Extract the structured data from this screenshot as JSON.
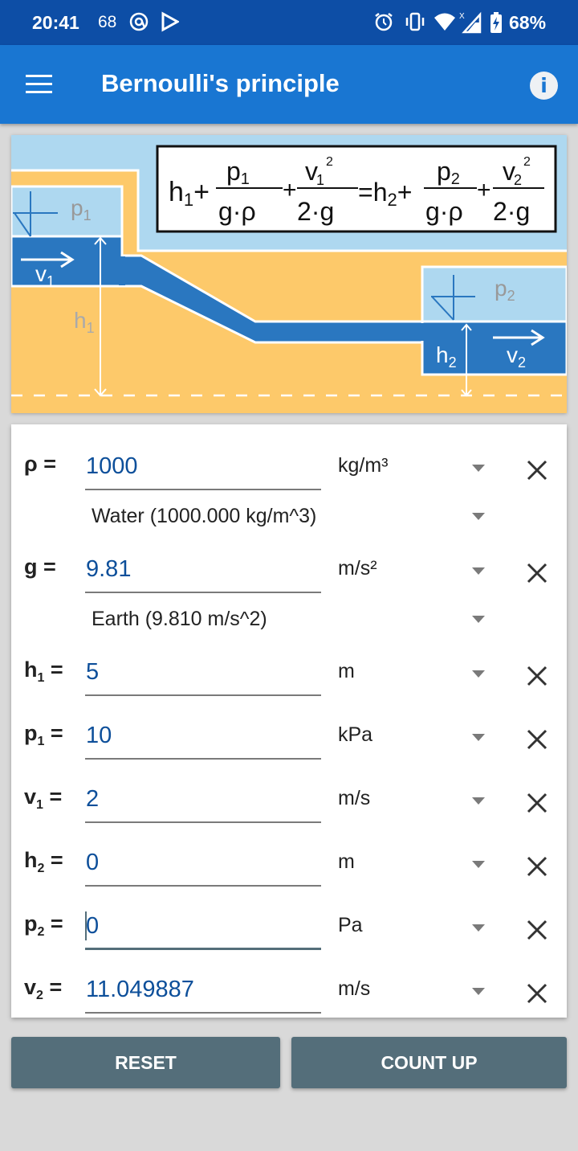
{
  "status_bar": {
    "time": "20:41",
    "notification_count": "68",
    "battery": "68%",
    "icons": [
      "at-sign-icon",
      "play-store-icon",
      "alarm-icon",
      "vibrate-icon",
      "wifi-icon",
      "signal-icon",
      "battery-charging-icon"
    ]
  },
  "app_bar": {
    "title": "Bernoulli's principle",
    "menu_icon": "hamburger-menu-icon",
    "info_icon": "info-icon"
  },
  "diagram": {
    "formula_lhs": [
      "h",
      "1",
      "p",
      "1",
      "g·ρ",
      "v",
      "1",
      "2",
      "2·g"
    ],
    "labels": {
      "p1": "p",
      "p1_sub": "1",
      "v1": "v",
      "v1_sub": "1",
      "h1": "h",
      "h1_sub": "1",
      "p2": "p",
      "p2_sub": "2",
      "v2": "v",
      "v2_sub": "2",
      "h2": "h",
      "h2_sub": "2"
    },
    "formula": {
      "h1": "h",
      "h1_sub": "1",
      "plus": "+",
      "eq": "=",
      "p1": "p",
      "p1_sub": "1",
      "den_gp": "g·ρ",
      "v1": "v",
      "v1_sub": "1",
      "sq": "2",
      "den_2g": "2·g",
      "h2": "h",
      "h2_sub": "2",
      "p2": "p",
      "p2_sub": "2",
      "v2": "v",
      "v2_sub": "2"
    },
    "colors": {
      "sky": "#aed8f0",
      "ground": "#fdc96a",
      "water_dark": "#2a77c0",
      "water_light": "#aed8f0"
    }
  },
  "fields": [
    {
      "symbol": "ρ",
      "sub": "",
      "value": "1000",
      "unit": "kg/m³",
      "preset": "Water (1000.000 kg/m^3)"
    },
    {
      "symbol": "g",
      "sub": "",
      "value": "9.81",
      "unit": "m/s²",
      "preset": "Earth (9.810 m/s^2)"
    },
    {
      "symbol": "h",
      "sub": "1",
      "value": "5",
      "unit": "m"
    },
    {
      "symbol": "p",
      "sub": "1",
      "value": "10",
      "unit": "kPa"
    },
    {
      "symbol": "v",
      "sub": "1",
      "value": "2",
      "unit": "m/s"
    },
    {
      "symbol": "h",
      "sub": "2",
      "value": "0",
      "unit": "m"
    },
    {
      "symbol": "p",
      "sub": "2",
      "value": "0",
      "unit": "Pa",
      "focused": true
    },
    {
      "symbol": "v",
      "sub": "2",
      "value": "11.049887",
      "unit": "m/s"
    }
  ],
  "eq_sign": "=",
  "buttons": {
    "reset": "RESET",
    "count_up": "COUNT UP"
  },
  "colors": {
    "status_bar": "#0d4ea6",
    "app_bar": "#1976d2",
    "value_text": "#0d4f9a",
    "button": "#546e7a",
    "background": "#d9d9d9"
  }
}
